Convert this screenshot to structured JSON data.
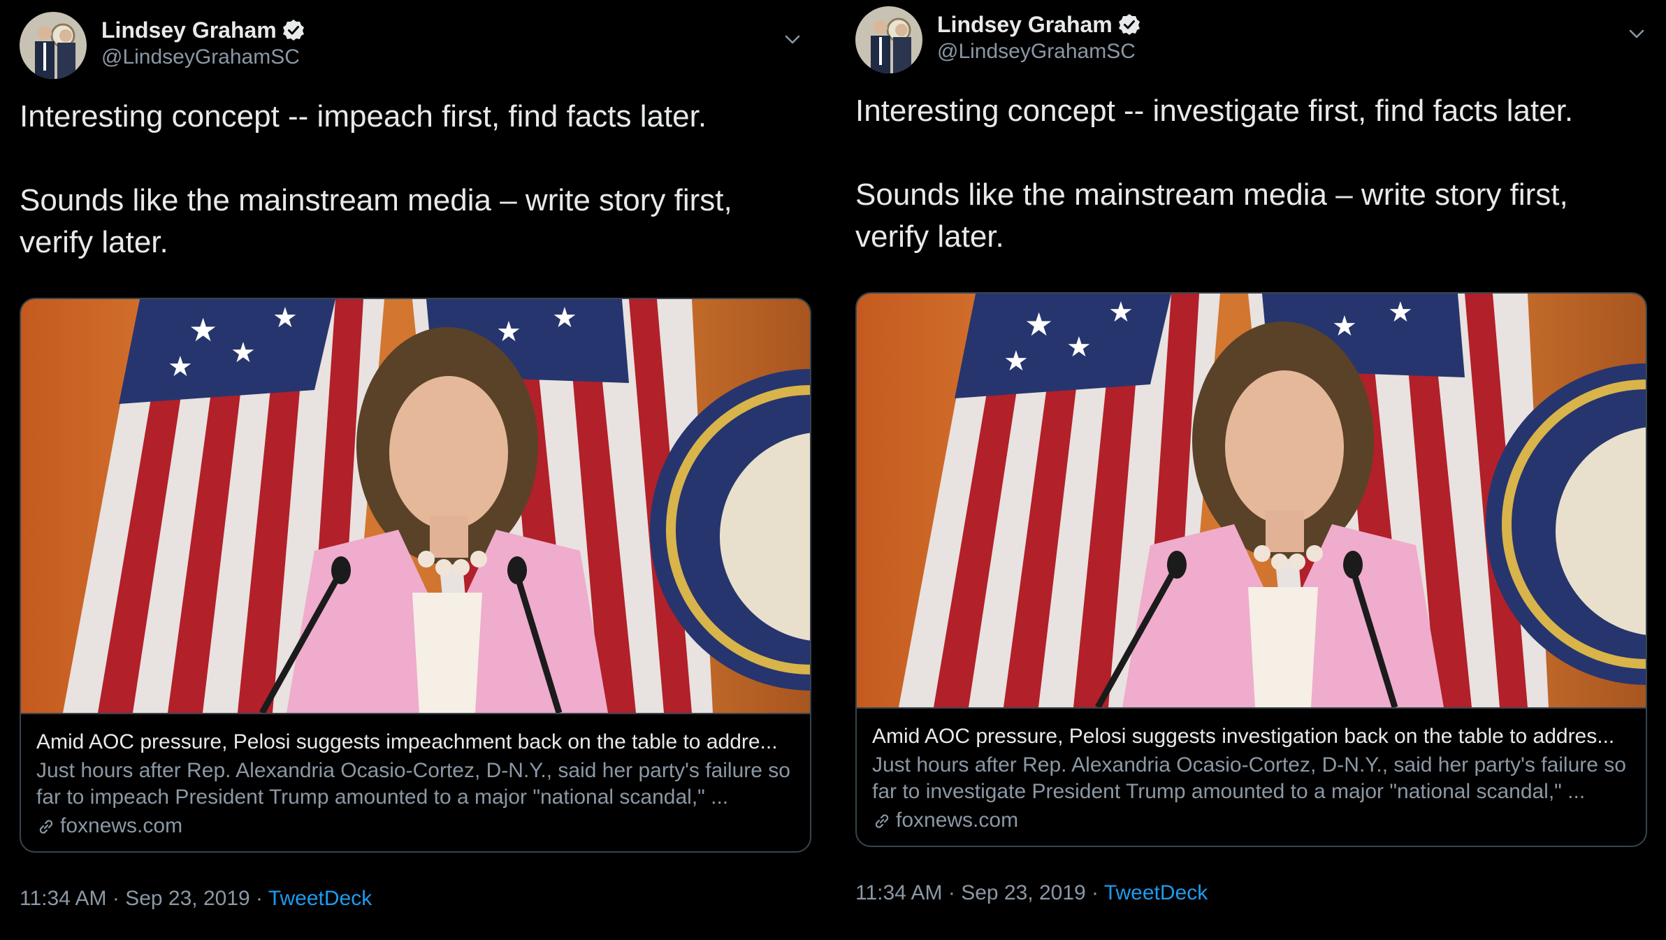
{
  "colors": {
    "background": "#000000",
    "primary_text": "#e7e9ea",
    "secondary_text": "#8b98a5",
    "link": "#1d9bf0",
    "border": "#38444d"
  },
  "icons": {
    "verified": "verified-badge-icon",
    "caret": "chevron-down-icon",
    "link": "link-icon"
  },
  "tweets": [
    {
      "author": {
        "name": "Lindsey Graham",
        "handle": "@LindseyGrahamSC"
      },
      "paragraph_1": "Interesting concept -- impeach first, find facts later.",
      "paragraph_2": "Sounds like the mainstream media – write story first, verify later.",
      "card": {
        "title": "Amid AOC pressure, Pelosi suggests impeachment back on the table to addre...",
        "description": "Just hours after Rep. Alexandria Ocasio-Cortez, D-N.Y., said her party's failure so far to impeach President Trump amounted to a major \"national scandal,\" ...",
        "domain": "foxnews.com"
      },
      "footer": {
        "time": "11:34 AM",
        "date": "Sep 23, 2019",
        "source": "TweetDeck",
        "separator": " · "
      }
    },
    {
      "author": {
        "name": "Lindsey Graham",
        "handle": "@LindseyGrahamSC"
      },
      "paragraph_1": "Interesting concept -- investigate first, find facts later.",
      "paragraph_2": "Sounds like the mainstream media – write story first, verify later.",
      "card": {
        "title": "Amid AOC pressure, Pelosi suggests investigation back on the table to addres...",
        "description": "Just hours after Rep. Alexandria Ocasio-Cortez, D-N.Y., said her party's failure so far to investigate President Trump amounted to a major \"national scandal,\" ...",
        "domain": "foxnews.com"
      },
      "footer": {
        "time": "11:34 AM",
        "date": "Sep 23, 2019",
        "source": "TweetDeck",
        "separator": " · "
      }
    }
  ]
}
